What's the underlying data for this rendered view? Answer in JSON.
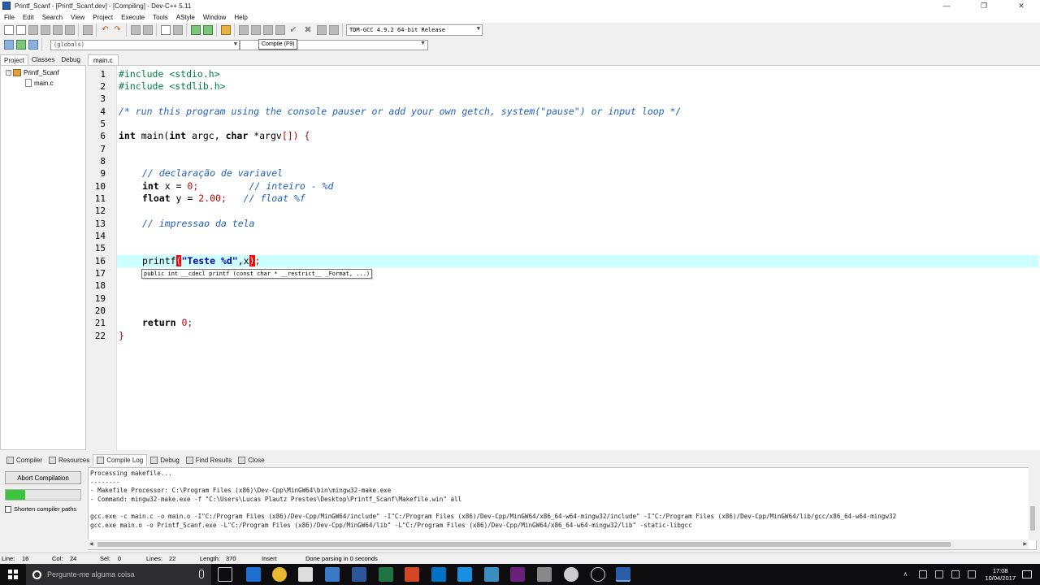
{
  "window": {
    "title": "Printf_Scanf - [Printf_Scanf.dev] - [Compiling] - Dev-C++ 5.11",
    "controls": [
      "—",
      "❐",
      "✕"
    ]
  },
  "menu": [
    "File",
    "Edit",
    "Search",
    "View",
    "Project",
    "Execute",
    "Tools",
    "AStyle",
    "Window",
    "Help"
  ],
  "toolbar": {
    "compiler_select": "TDM-GCC 4.9.2 64-bit Release",
    "globals_select": "(globals)",
    "tooltip": "Compile (F9)"
  },
  "left_panel": {
    "tabs": [
      "Project",
      "Classes",
      "Debug"
    ],
    "tree": {
      "project": "Printf_Scanf",
      "file": "main.c"
    }
  },
  "editor": {
    "tab": "main.c",
    "line_numbers": [
      "1",
      "2",
      "3",
      "4",
      "5",
      "6",
      "7",
      "8",
      "9",
      "10",
      "11",
      "12",
      "13",
      "14",
      "15",
      "16",
      "17",
      "18",
      "19",
      "20",
      "21",
      "22"
    ],
    "code": {
      "l1_a": "#include ",
      "l1_b": "<stdio.h>",
      "l2_a": "#include ",
      "l2_b": "<stdlib.h>",
      "l4": "/* run this program using the console pauser or add your own getch, system(\"pause\") or input loop */",
      "l6_kw1": "int",
      "l6_mid": " main(",
      "l6_kw2": "int",
      "l6_mid2": " argc, ",
      "l6_kw3": "char",
      "l6_mid3": " *argv",
      "l6_end": "[]) {",
      "l9": "// declaração de variavel",
      "l10_kw": "int",
      "l10_mid": " x = ",
      "l10_num": "0",
      "l10_semi": ";",
      "l10_cm": "// inteiro - %d",
      "l11_kw": "float",
      "l11_mid": " y = ",
      "l11_num": "2.00",
      "l11_semi": ";",
      "l11_cm": "// float %f",
      "l13": "// impressao da tela",
      "l16_fn": "printf",
      "l16_open": "(",
      "l16_str": "\"Teste %d\"",
      "l16_mid": ",x",
      "l16_close": ")",
      "l16_semi": ";",
      "l21_kw": "return",
      "l21_num": "0",
      "l21_semi": ";",
      "l22": "}"
    },
    "hint": "public int __cdecl printf (const char * __restrict__ _Format, ...)",
    "current_line": 16
  },
  "bottom_tabs": [
    "Compiler",
    "Resources",
    "Compile Log",
    "Debug",
    "Find Results",
    "Close"
  ],
  "bottom_left": {
    "abort": "Abort Compilation",
    "progress": 0.26,
    "shorten": "Shorten compiler paths"
  },
  "log": [
    "Processing makefile...",
    "--------",
    "- Makefile Processor: C:\\Program Files (x86)\\Dev-Cpp\\MinGW64\\bin\\mingw32-make.exe",
    "- Command: mingw32-make.exe -f \"C:\\Users\\Lucas Plautz Prestes\\Desktop\\Printf_Scanf\\Makefile.win\" all",
    "",
    "gcc.exe -c main.c -o main.o -I\"C:/Program Files (x86)/Dev-Cpp/MinGW64/include\" -I\"C:/Program Files (x86)/Dev-Cpp/MinGW64/x86_64-w64-mingw32/include\" -I\"C:/Program Files (x86)/Dev-Cpp/MinGW64/lib/gcc/x86_64-w64-mingw32",
    "gcc.exe main.o -o Printf_Scanf.exe -L\"C:/Program Files (x86)/Dev-Cpp/MinGW64/lib\" -L\"C:/Program Files (x86)/Dev-Cpp/MinGW64/x86_64-w64-mingw32/lib\" -static-libgcc"
  ],
  "status": {
    "line_label": "Line:",
    "line": "16",
    "col_label": "Col:",
    "col": "24",
    "sel_label": "Sel:",
    "sel": "0",
    "lines_label": "Lines:",
    "lines": "22",
    "length_label": "Length:",
    "length": "370",
    "mode": "Insert",
    "message": "Done parsing in 0 seconds"
  },
  "taskbar": {
    "search_placeholder": "Pergunte-me alguma coisa",
    "time": "17:08",
    "date": "10/04/2017"
  },
  "colors": {
    "current_line": "#ccffff",
    "keyword": "#000000",
    "comment": "#2060c0",
    "number": "#c00000",
    "string": "#0000c0",
    "preprocessor": "#008040",
    "bracket_match": "#ff0000"
  }
}
